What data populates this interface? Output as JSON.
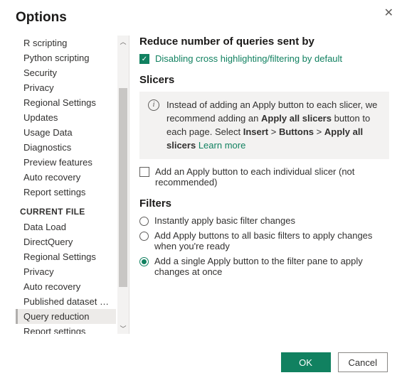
{
  "dialog": {
    "title": "Options"
  },
  "sidebar": {
    "global": [
      "R scripting",
      "Python scripting",
      "Security",
      "Privacy",
      "Regional Settings",
      "Updates",
      "Usage Data",
      "Diagnostics",
      "Preview features",
      "Auto recovery",
      "Report settings"
    ],
    "section_header": "CURRENT FILE",
    "current_file": [
      "Data Load",
      "DirectQuery",
      "Regional Settings",
      "Privacy",
      "Auto recovery",
      "Published dataset set...",
      "Query reduction",
      "Report settings"
    ],
    "selected": "Query reduction"
  },
  "content": {
    "heading": "Reduce number of queries sent by",
    "checkbox1_label": "Disabling cross highlighting/filtering by default",
    "slicers_heading": "Slicers",
    "info_text_1": "Instead of adding an Apply button to each slicer, we recommend adding an ",
    "info_bold_1": "Apply all slicers",
    "info_text_2": " button to each page. Select ",
    "info_bold_2": "Insert",
    "info_sep_1": " > ",
    "info_bold_3": "Buttons",
    "info_sep_2": " > ",
    "info_bold_4": "Apply all slicers",
    "info_learn_more": "Learn more",
    "checkbox2_label": "Add an Apply button to each individual slicer (not recommended)",
    "filters_heading": "Filters",
    "radio1_label": "Instantly apply basic filter changes",
    "radio2_label": "Add Apply buttons to all basic filters to apply changes when you're ready",
    "radio3_label": "Add a single Apply button to the filter pane to apply changes at once"
  },
  "buttons": {
    "ok": "OK",
    "cancel": "Cancel"
  }
}
